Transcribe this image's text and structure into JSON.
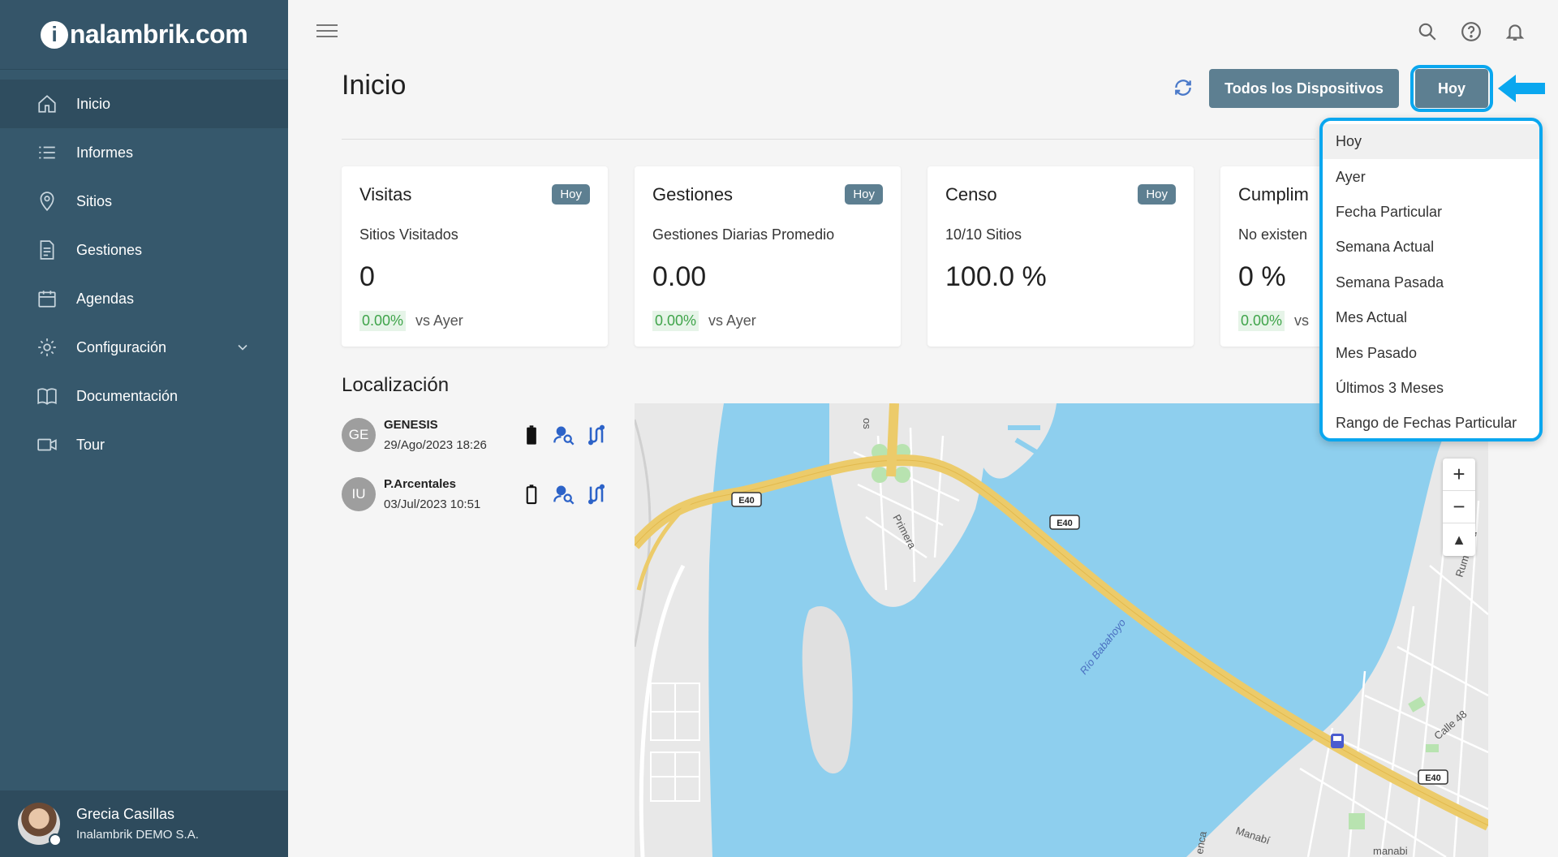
{
  "brand": {
    "mark": "i",
    "name": "nalambrik.com"
  },
  "sidebar": {
    "items": [
      {
        "label": "Inicio",
        "icon": "home-icon",
        "active": true
      },
      {
        "label": "Informes",
        "icon": "list-icon"
      },
      {
        "label": "Sitios",
        "icon": "location-pin-icon"
      },
      {
        "label": "Gestiones",
        "icon": "document-icon"
      },
      {
        "label": "Agendas",
        "icon": "calendar-icon"
      },
      {
        "label": "Configuración",
        "icon": "gear-icon"
      },
      {
        "label": "Documentación",
        "icon": "book-icon"
      },
      {
        "label": "Tour",
        "icon": "video-camera-icon"
      }
    ]
  },
  "user": {
    "name": "Grecia Casillas",
    "org": "Inalambrik DEMO S.A."
  },
  "header": {
    "title": "Inicio",
    "devices_button": "Todos los Dispositivos",
    "period_button": "Hoy"
  },
  "cards": [
    {
      "title": "Visitas",
      "badge": "Hoy",
      "sub": "Sitios Visitados",
      "value": "0",
      "pct": "0.00%",
      "cmp": "vs Ayer"
    },
    {
      "title": "Gestiones",
      "badge": "Hoy",
      "sub": "Gestiones Diarias Promedio",
      "value": "0.00",
      "pct": "0.00%",
      "cmp": "vs Ayer"
    },
    {
      "title": "Censo",
      "badge": "Hoy",
      "sub": "10/10 Sitios",
      "value": "100.0 %"
    },
    {
      "title": "Cumplim",
      "sub": "No existen",
      "value": "0 %",
      "pct": "0.00%",
      "cmp": "vs"
    }
  ],
  "localizacion": {
    "title": "Localización",
    "devices": [
      {
        "initials": "GE",
        "name": "GENESIS",
        "time": "29/Ago/2023 18:26"
      },
      {
        "initials": "IU",
        "name": "P.Arcentales",
        "time": "03/Jul/2023 10:51"
      }
    ]
  },
  "map": {
    "labels": {
      "e40_a": "E40",
      "e40_b": "E40",
      "e40_c": "E40",
      "primera": "Primera",
      "rio": "Río Babahoyo",
      "calle48": "Calle 48",
      "manabi": "Manabí",
      "manabi2": "manabi",
      "ruminahui": "Rumiñahu",
      "os": "os",
      "venca": "enca"
    },
    "zoom_in": "+",
    "zoom_out": "−",
    "compass": "▲"
  },
  "dropdown": {
    "options": [
      "Hoy",
      "Ayer",
      "Fecha Particular",
      "Semana Actual",
      "Semana Pasada",
      "Mes Actual",
      "Mes Pasado",
      "Últimos 3 Meses",
      "Rango de Fechas Particular"
    ],
    "selected": "Hoy"
  },
  "colors": {
    "sidebar": "#36586c",
    "accent_button": "#5d7f91",
    "highlight": "#0aa7ef",
    "water": "#8ecfee",
    "road": "#eccb6a",
    "positive": "#3fa44a"
  }
}
